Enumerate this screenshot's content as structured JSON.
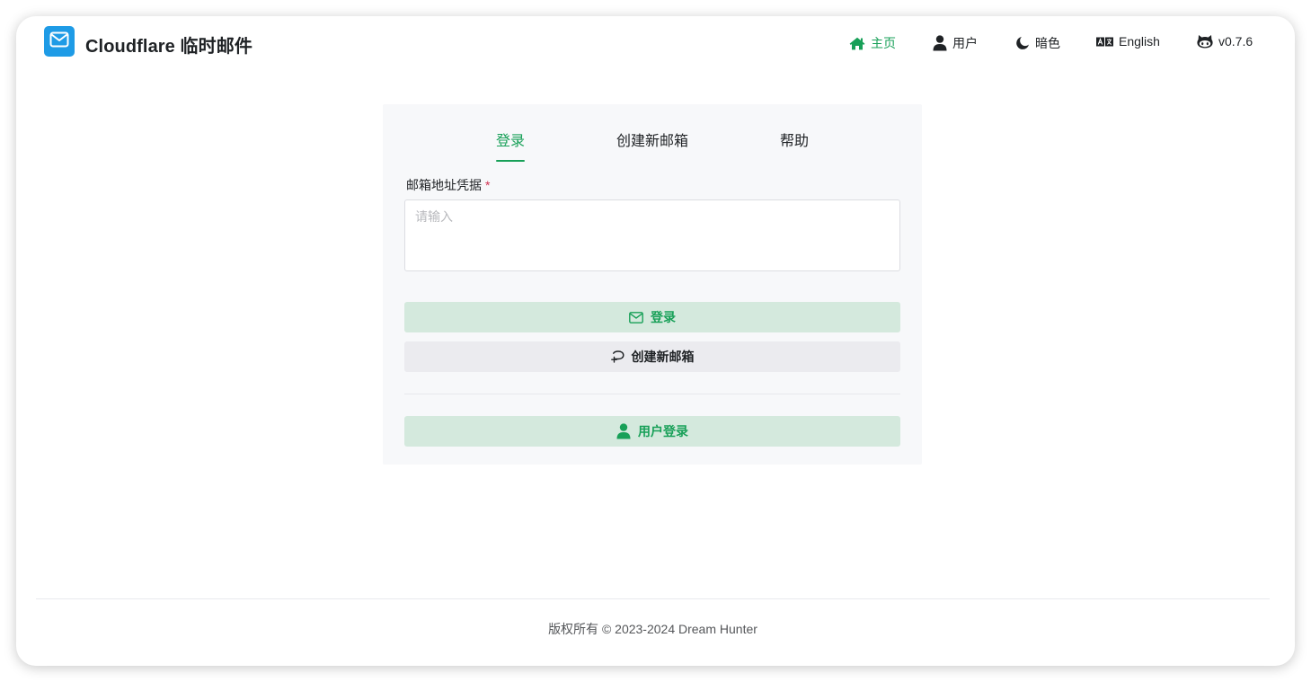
{
  "header": {
    "app_title": "Cloudflare 临时邮件",
    "logo_icon": "mail-icon",
    "nav": [
      {
        "label": "主页",
        "icon": "home-icon",
        "active": true
      },
      {
        "label": "用户",
        "icon": "user-icon",
        "active": false
      },
      {
        "label": "暗色",
        "icon": "moon-icon",
        "active": false
      },
      {
        "label": "English",
        "icon": "translate-icon",
        "active": false
      },
      {
        "label": "v0.7.6",
        "icon": "github-icon",
        "active": false
      }
    ]
  },
  "card": {
    "tabs": [
      {
        "label": "登录",
        "active": true
      },
      {
        "label": "创建新邮箱",
        "active": false
      },
      {
        "label": "帮助",
        "active": false
      }
    ],
    "field": {
      "label": "邮箱地址凭据",
      "required_mark": "*",
      "value": "",
      "placeholder": "请输入"
    },
    "buttons": {
      "login": "登录",
      "create": "创建新邮箱",
      "user_login": "用户登录"
    }
  },
  "footer": {
    "copyright": "版权所有 © 2023-2024 Dream Hunter"
  },
  "colors": {
    "accent": "#18a058",
    "accent_bg": "#d4e9dd",
    "logo_bg": "#1e9be6",
    "required": "#d03050"
  }
}
